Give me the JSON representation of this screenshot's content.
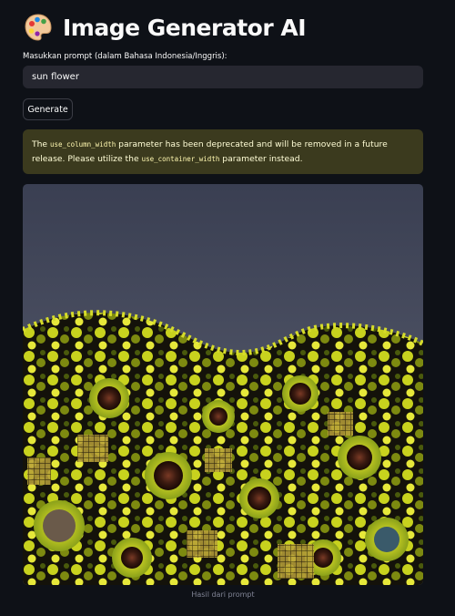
{
  "app": {
    "title": "Image Generator AI",
    "title_icon": "artist-palette-icon"
  },
  "form": {
    "prompt_label": "Masukkan prompt (dalam Bahasa Indonesia/Inggris):",
    "prompt_value": "sun flower",
    "generate_label": "Generate"
  },
  "warning": {
    "text_1": "The ",
    "code_1": "use_column_width",
    "text_2": " parameter has been deprecated and will be removed in a future release. Please utilize the ",
    "code_2": "use_container_width",
    "text_3": " parameter instead."
  },
  "result": {
    "caption": "Hasil dari prompt",
    "image_subject": "generated-sunflower-field-image"
  },
  "colors": {
    "background": "#0e1117",
    "input_bg": "#262730",
    "warning_bg": "#3b3a1e",
    "warning_text": "#fffdd6",
    "caption_text": "#808495"
  }
}
